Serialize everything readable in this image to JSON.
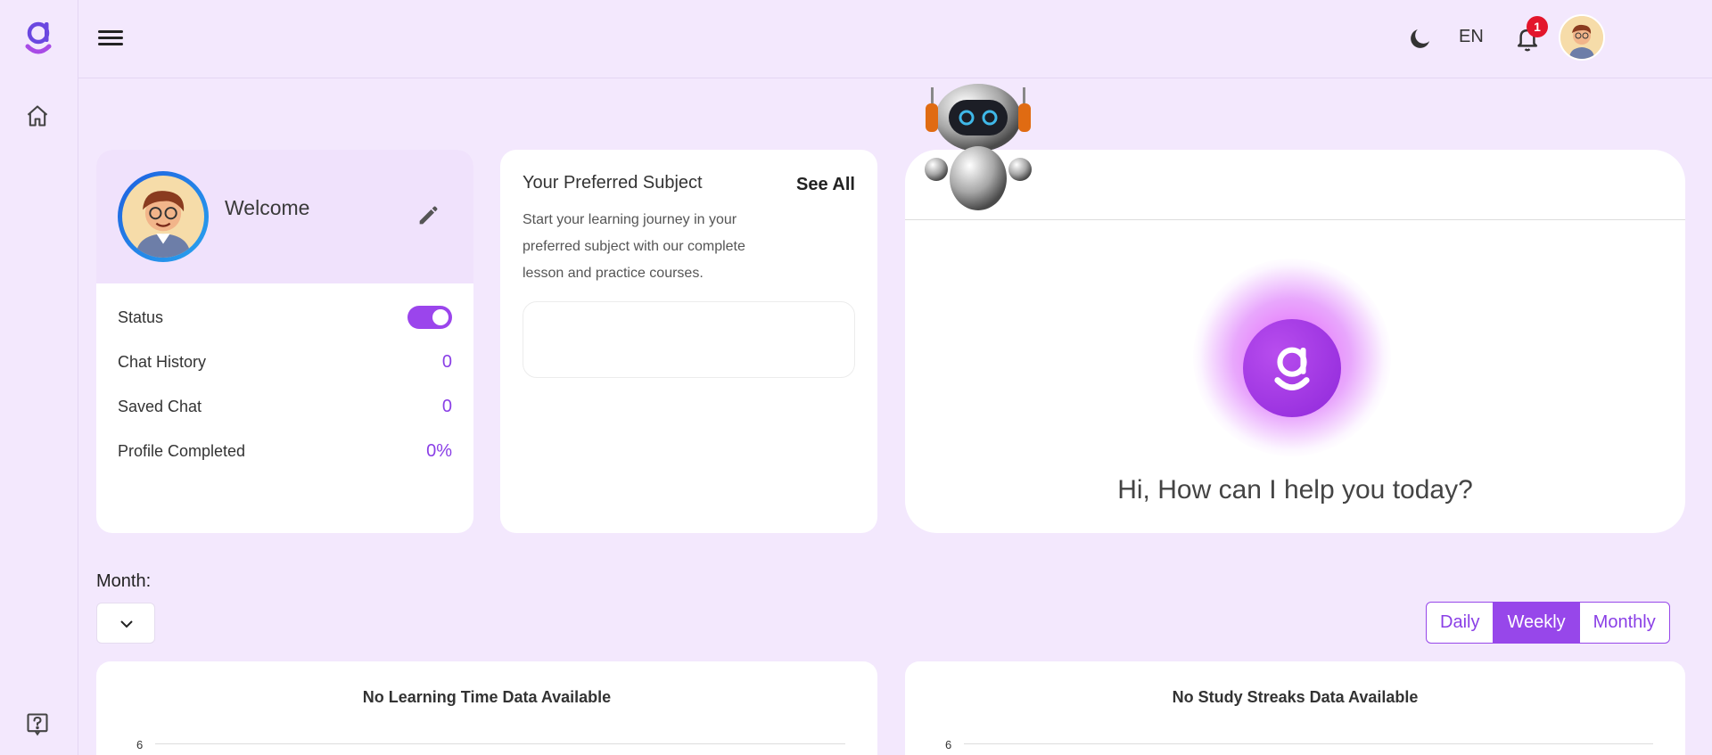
{
  "topbar": {
    "language": "EN",
    "notification_count": "1"
  },
  "welcome": {
    "title": "Welcome",
    "stats": [
      {
        "label": "Status",
        "value": "on"
      },
      {
        "label": "Chat History",
        "value": "0"
      },
      {
        "label": "Saved Chat",
        "value": "0"
      },
      {
        "label": "Profile Completed",
        "value": "0%"
      }
    ]
  },
  "subject": {
    "title": "Your Preferred Subject",
    "see_all": "See All",
    "description": "Start your learning journey in your preferred subject with our complete lesson and practice courses."
  },
  "chat": {
    "greeting": "Hi, How can I help you today?"
  },
  "filters": {
    "month_label": "Month:",
    "periods": [
      "Daily",
      "Weekly",
      "Monthly"
    ],
    "active_period": "Weekly"
  },
  "charts": [
    {
      "title": "No Learning Time Data Available",
      "y_tick": "6"
    },
    {
      "title": "No Study Streaks Data Available",
      "y_tick": "6"
    }
  ],
  "colors": {
    "accent": "#9747ea",
    "background": "#f3e8fd",
    "badge": "#e3152b"
  }
}
